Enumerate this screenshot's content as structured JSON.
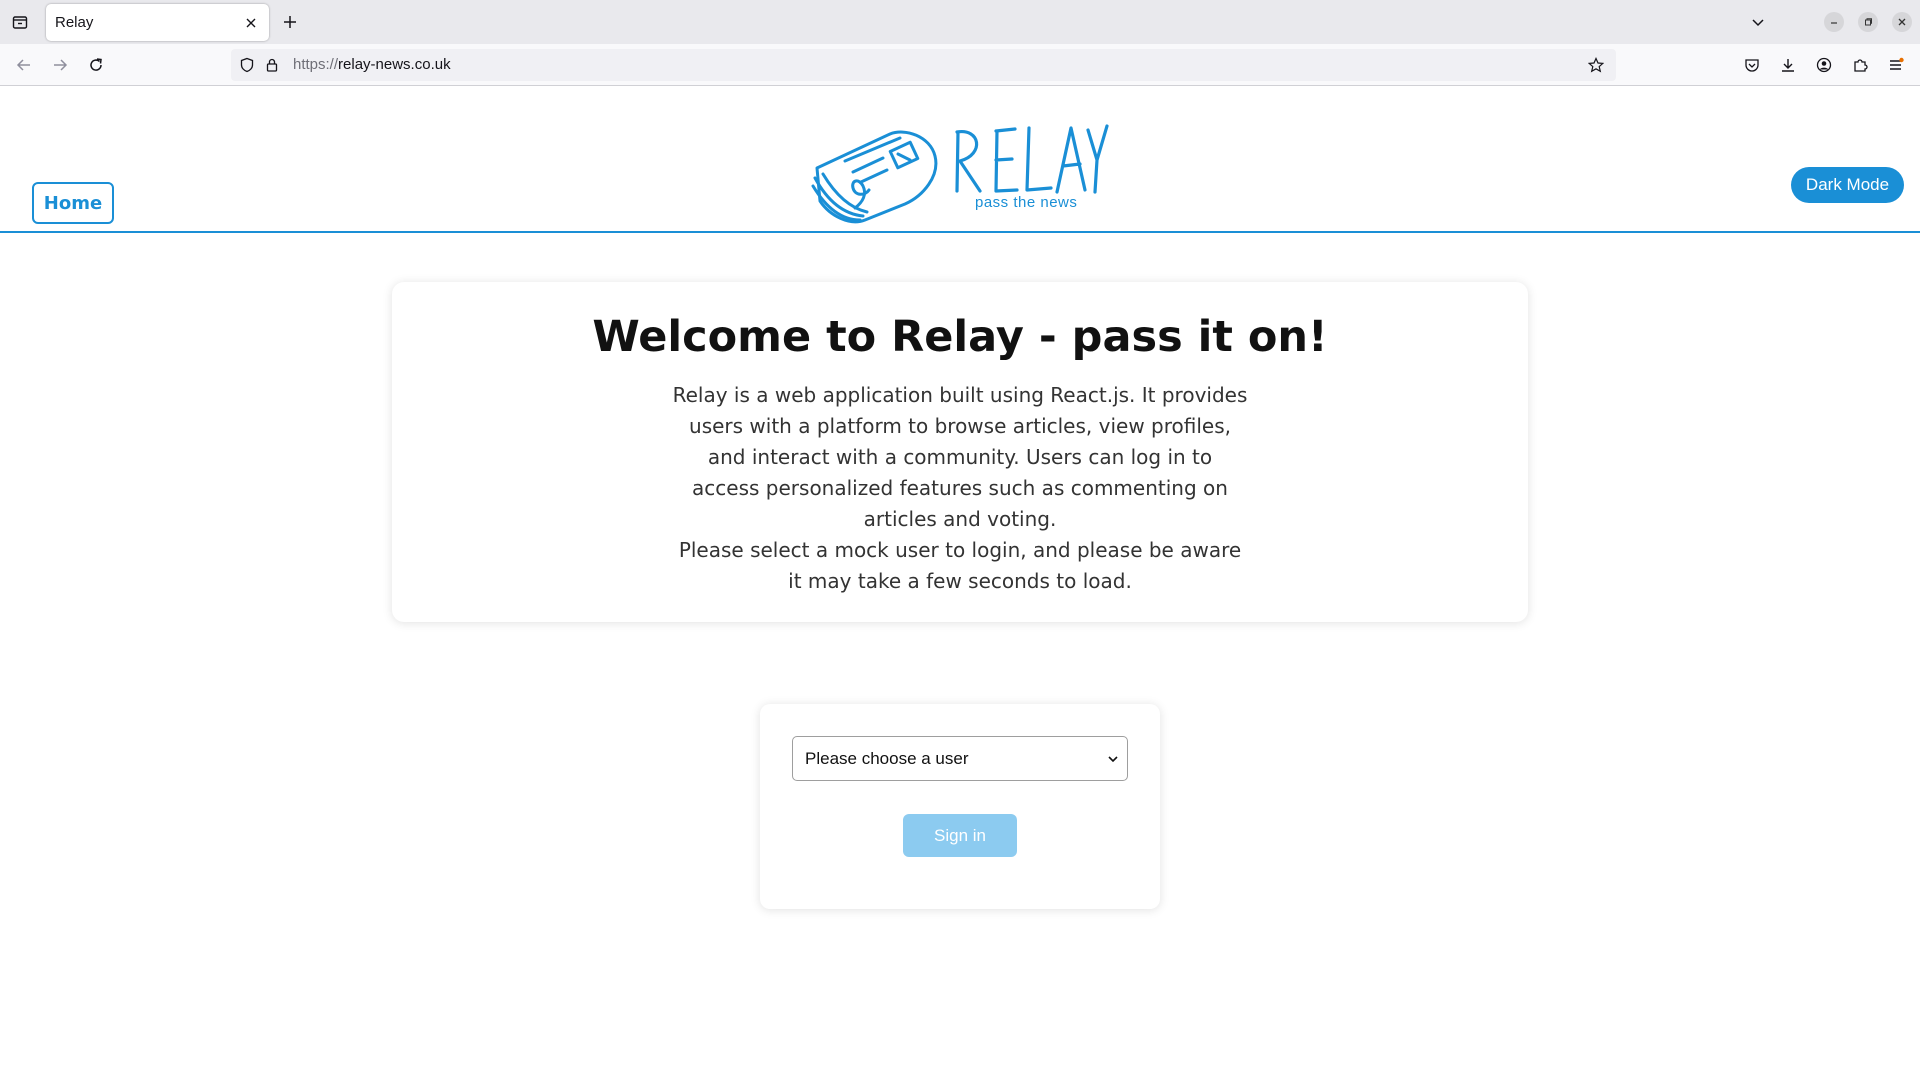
{
  "browser": {
    "tab_title": "Relay",
    "url_scheme": "https://",
    "url_host": "relay-news.co.uk"
  },
  "header": {
    "home_label": "Home",
    "logo_text": "RELAY",
    "logo_tagline": "pass the news",
    "dark_mode_label": "Dark Mode"
  },
  "welcome": {
    "title": "Welcome to Relay - pass it on!",
    "paragraph_1": "Relay is a web application built using React.js. It provides users with a platform to browse articles, view profiles, and interact with a community. Users can log in to access personalized features such as commenting on articles and voting.",
    "paragraph_2": "Please select a mock user to login, and please be aware it may take a few seconds to load."
  },
  "login": {
    "select_value": "Please choose a user",
    "sign_in_label": "Sign in"
  },
  "colors": {
    "brand": "#1a8fd6",
    "sign_in_disabled": "#8ccbf0"
  }
}
